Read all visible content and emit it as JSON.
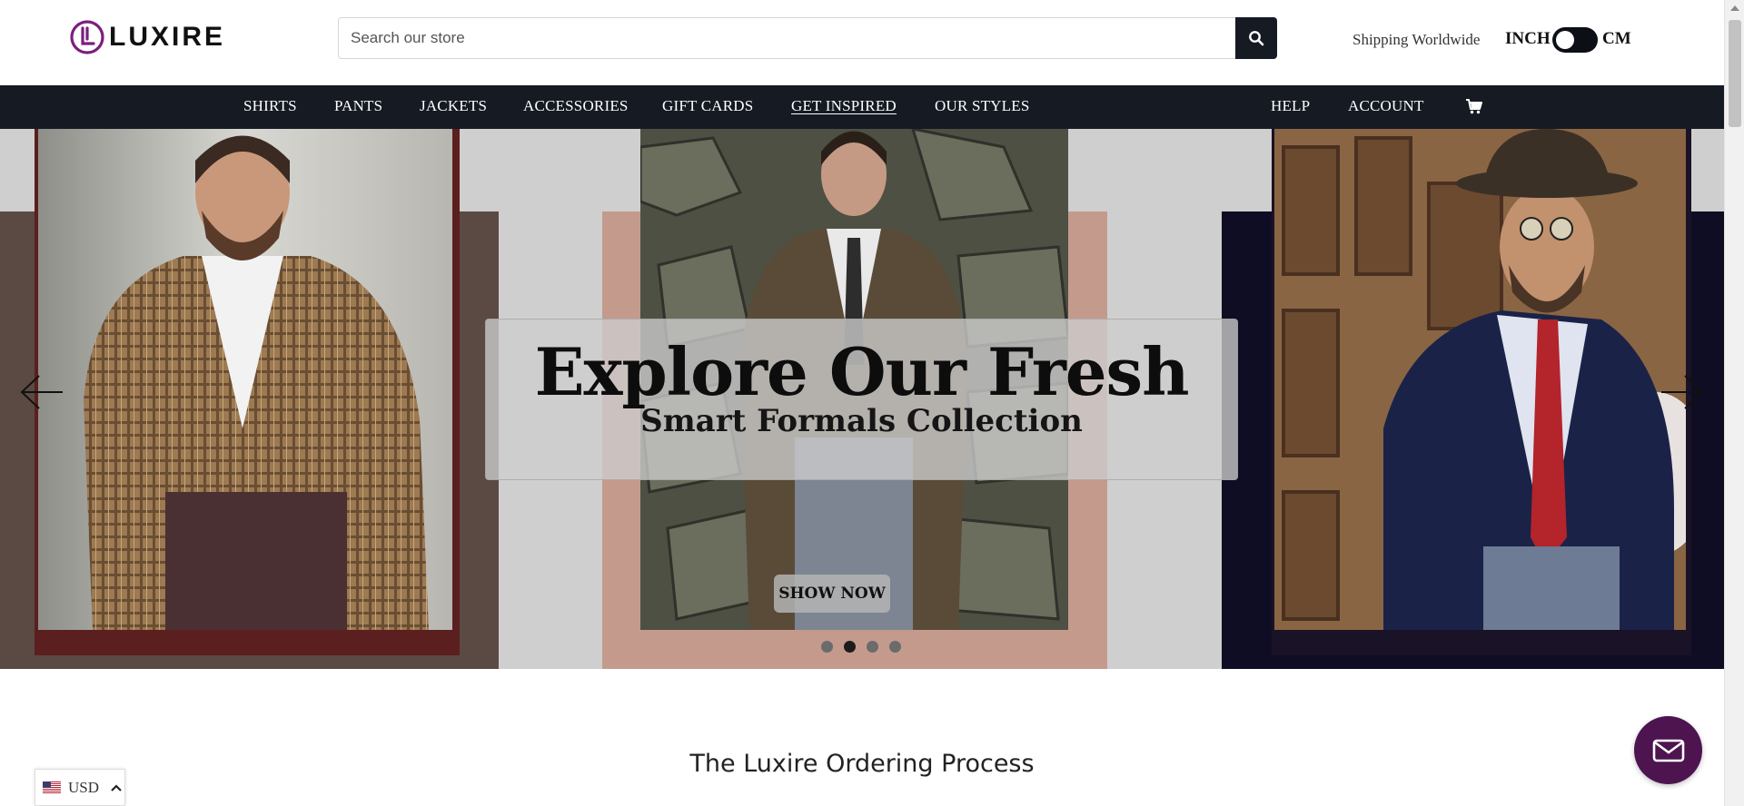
{
  "brand": {
    "name": "LUXIRE",
    "accent": "#7b1e7e"
  },
  "search": {
    "placeholder": "Search our store",
    "icon": "search-icon"
  },
  "header": {
    "shipping_text": "Shipping Worldwide",
    "unit_left": "INCH",
    "unit_right": "CM"
  },
  "nav": {
    "left_items": [
      {
        "label": "SHIRTS"
      },
      {
        "label": "PANTS"
      },
      {
        "label": "JACKETS"
      },
      {
        "label": "ACCESSORIES"
      },
      {
        "label": "GIFT CARDS"
      },
      {
        "label": "GET INSPIRED"
      },
      {
        "label": "OUR STYLES"
      }
    ],
    "right_items": [
      {
        "label": "HELP"
      },
      {
        "label": "ACCOUNT"
      }
    ],
    "cart_icon": "cart-icon",
    "background": "#151a23"
  },
  "hero": {
    "title": "Explore Our Fresh",
    "subtitle": "Smart Formals Collection",
    "cta": "SHOW NOW",
    "slides_total": 4,
    "active_slide": 2
  },
  "section": {
    "title": "The Luxire Ordering Process"
  },
  "currency": {
    "code": "USD"
  },
  "chat": {
    "icon": "mail-icon",
    "color": "#4d1450"
  }
}
